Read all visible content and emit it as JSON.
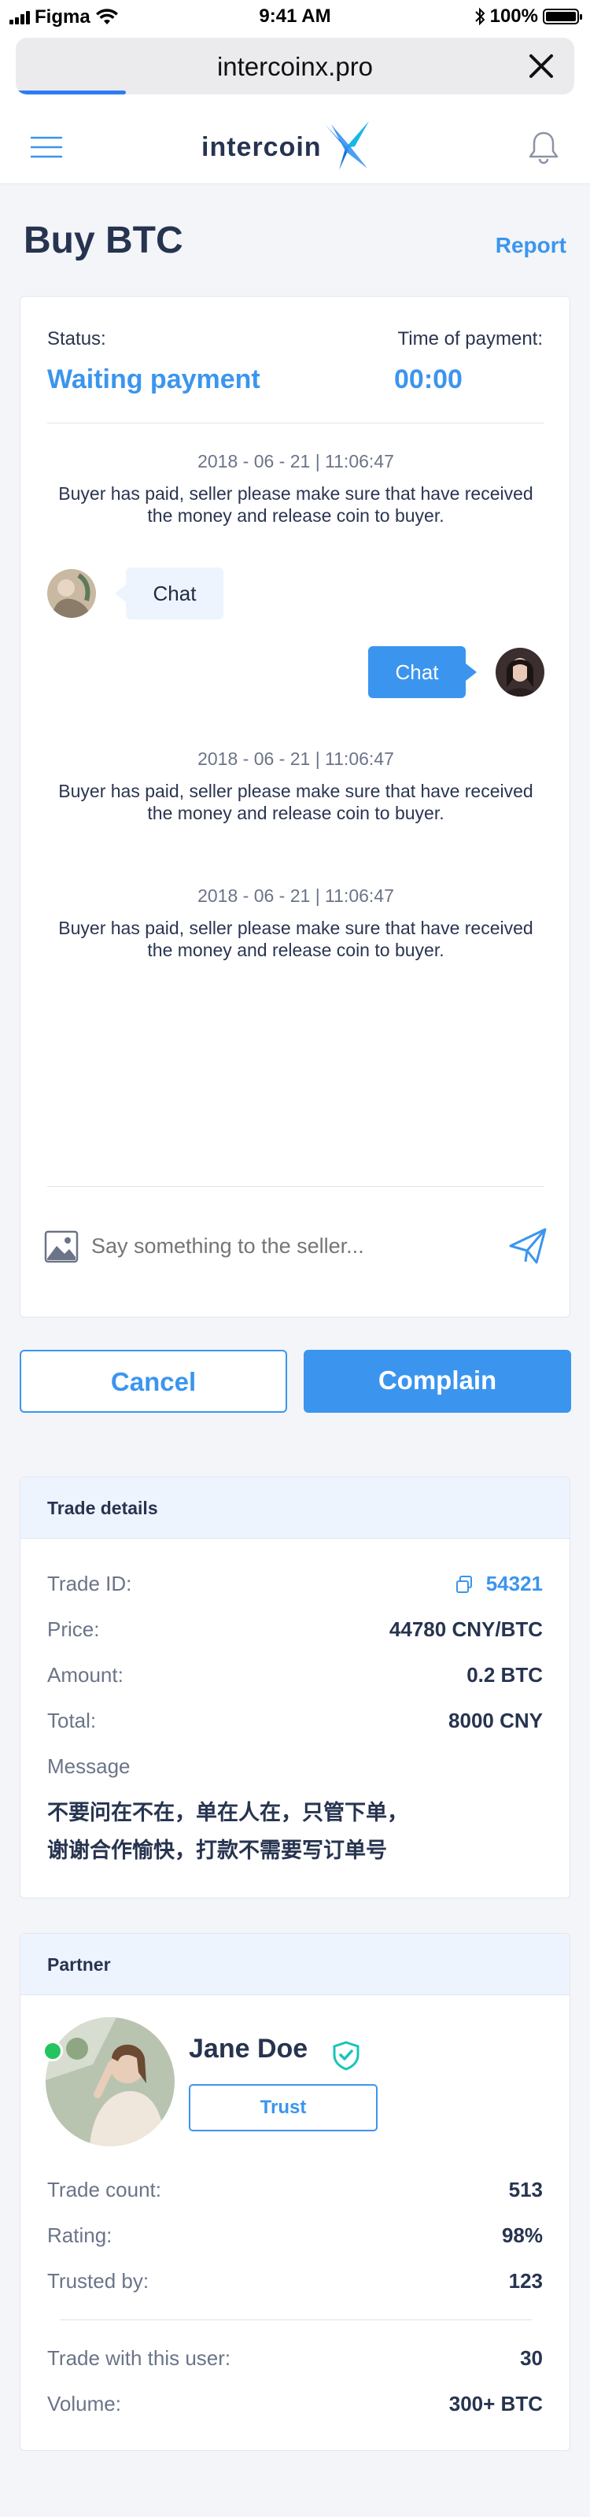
{
  "status_bar": {
    "carrier": "Figma",
    "time": "9:41 AM",
    "battery": "100%"
  },
  "browser": {
    "url": "intercoinx.pro"
  },
  "header": {
    "logo_text": "intercoin"
  },
  "page": {
    "title": "Buy BTC",
    "report_label": "Report"
  },
  "chat": {
    "status_label": "Status:",
    "status_value": "Waiting payment",
    "time_label": "Time of payment:",
    "time_value": "00:00",
    "system_messages": [
      {
        "time": "2018 - 06 - 21 | 11:06:47",
        "text": "Buyer has paid, seller please make sure that have received the money and release coin to buyer."
      },
      {
        "time": "2018 - 06 - 21 | 11:06:47",
        "text": "Buyer has paid, seller please make sure that have received the money and release coin to buyer."
      },
      {
        "time": "2018 - 06 - 21 | 11:06:47",
        "text": "Buyer has paid, seller please make sure that have received the money and release coin to buyer."
      }
    ],
    "incoming_message": "Chat",
    "outgoing_message": "Chat",
    "input_placeholder": "Say something to the seller..."
  },
  "actions": {
    "cancel_label": "Cancel",
    "complain_label": "Complain"
  },
  "trade_details": {
    "heading": "Trade details",
    "trade_id_label": "Trade ID:",
    "trade_id_value": "54321",
    "price_label": "Price:",
    "price_value": "44780 CNY/BTC",
    "amount_label": "Amount:",
    "amount_value": "0.2 BTC",
    "total_label": "Total:",
    "total_value": "8000 CNY",
    "message_label": "Message",
    "message_lines": [
      "不要问在不在，单在人在，只管下单，",
      "谢谢合作愉快，打款不需要写订单号"
    ]
  },
  "partner": {
    "heading": "Partner",
    "name": "Jane Doe",
    "trust_label": "Trust",
    "online_color": "#22c55e",
    "verified_color": "#19c5b8",
    "stats": [
      {
        "label": "Trade count:",
        "value": "513"
      },
      {
        "label": "Rating:",
        "value": "98%"
      },
      {
        "label": "Trusted by:",
        "value": "123"
      }
    ],
    "history": [
      {
        "label": "Trade with this user:",
        "value": "30"
      },
      {
        "label": "Volume:",
        "value": "300+ BTC"
      }
    ]
  },
  "colors": {
    "accent": "#3b95ee",
    "text": "#273450",
    "muted": "#6b7488",
    "background": "#f3f5f9"
  }
}
